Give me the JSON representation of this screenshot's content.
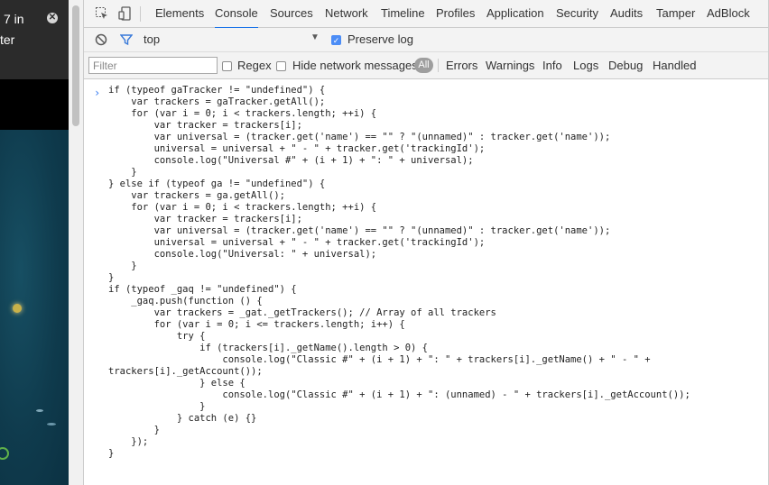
{
  "left_page": {
    "text_line_1": "7 in",
    "text_line_2": "ter",
    "close_icon": "close-circle-icon"
  },
  "devtools": {
    "toolbar_icons": [
      "inspect-element-icon",
      "device-toolbar-icon"
    ],
    "tabs": [
      {
        "label": "Elements",
        "active": false
      },
      {
        "label": "Console",
        "active": true
      },
      {
        "label": "Sources",
        "active": false
      },
      {
        "label": "Network",
        "active": false
      },
      {
        "label": "Timeline",
        "active": false
      },
      {
        "label": "Profiles",
        "active": false
      },
      {
        "label": "Application",
        "active": false
      },
      {
        "label": "Security",
        "active": false
      },
      {
        "label": "Audits",
        "active": false
      },
      {
        "label": "Tamper",
        "active": false
      },
      {
        "label": "AdBlock",
        "active": false
      }
    ],
    "console_toolbar": {
      "context": "top",
      "preserve_log_label": "Preserve log",
      "preserve_log_checked": true
    },
    "filter_bar": {
      "filter_placeholder": "Filter",
      "regex_label": "Regex",
      "regex_checked": false,
      "hide_network_label": "Hide network messages",
      "hide_network_checked": false,
      "levels": [
        "All",
        "Errors",
        "Warnings",
        "Info",
        "Logs",
        "Debug",
        "Handled"
      ],
      "selected_level": "All"
    },
    "console": {
      "prompt_symbol": "›",
      "code": "if (typeof gaTracker != \"undefined\") {\n    var trackers = gaTracker.getAll();\n    for (var i = 0; i < trackers.length; ++i) {\n        var tracker = trackers[i];\n        var universal = (tracker.get('name') == \"\" ? \"(unnamed)\" : tracker.get('name'));\n        universal = universal + \" - \" + tracker.get('trackingId');\n        console.log(\"Universal #\" + (i + 1) + \": \" + universal);\n    }\n} else if (typeof ga != \"undefined\") {\n    var trackers = ga.getAll();\n    for (var i = 0; i < trackers.length; ++i) {\n        var tracker = trackers[i];\n        var universal = (tracker.get('name') == \"\" ? \"(unnamed)\" : tracker.get('name'));\n        universal = universal + \" - \" + tracker.get('trackingId');\n        console.log(\"Universal: \" + universal);\n    }\n}\nif (typeof _gaq != \"undefined\") {\n    _gaq.push(function () {\n        var trackers = _gat._getTrackers(); // Array of all trackers\n        for (var i = 0; i <= trackers.length; i++) {\n            try {\n                if (trackers[i]._getName().length > 0) {\n                    console.log(\"Classic #\" + (i + 1) + \": \" + trackers[i]._getName() + \" - \" +\ntrackers[i]._getAccount());\n                } else {\n                    console.log(\"Classic #\" + (i + 1) + \": (unnamed) - \" + trackers[i]._getAccount());\n                }\n            } catch (e) {}\n        }\n    });\n}"
    }
  },
  "colors": {
    "accent": "#1a73e8",
    "checkbox_checked": "#4c8df6",
    "left_pane_bg": "#0e3a4c"
  }
}
